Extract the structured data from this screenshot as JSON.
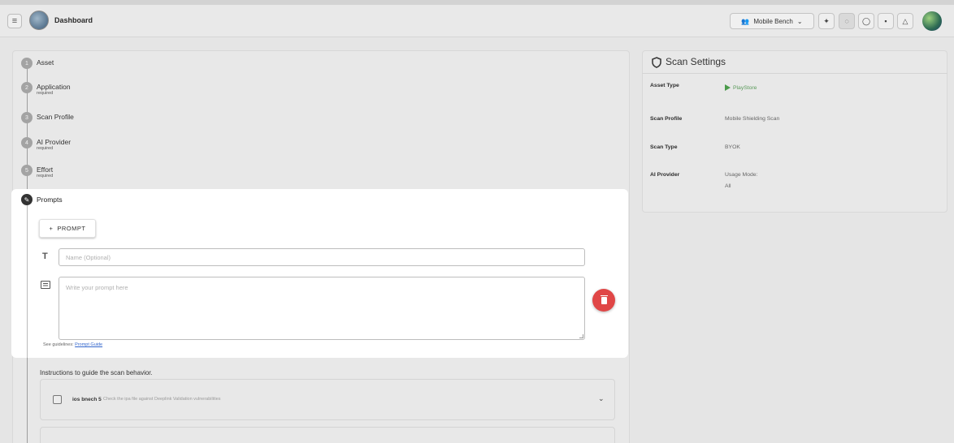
{
  "header": {
    "menu_icon": "hamburger-icon",
    "title": "Dashboard",
    "workspace_label": "Mobile Bench",
    "icons": [
      "sparkle-icon",
      "bug-icon",
      "shield-icon",
      "card-icon",
      "bell-icon"
    ]
  },
  "steps": [
    {
      "num": "1",
      "label": "Asset",
      "sub": ""
    },
    {
      "num": "2",
      "label": "Application",
      "sub": "required"
    },
    {
      "num": "3",
      "label": "Scan Profile",
      "sub": ""
    },
    {
      "num": "4",
      "label": "AI Provider",
      "sub": "required"
    },
    {
      "num": "5",
      "label": "Effort",
      "sub": "required"
    }
  ],
  "prompts": {
    "title": "Prompts",
    "add_label": "PROMPT",
    "add_plus": "+",
    "name_placeholder": "Name (Optional)",
    "prompt_placeholder": "Write your prompt here",
    "guide_text": "See guidelines:",
    "guide_link": "Prompt Guide"
  },
  "instructions": {
    "text": "Instructions to guide the scan behavior.",
    "items": [
      {
        "name": "ios bnech 5",
        "desc": "Check the ipa file against Deeplink Validation vulnerabilities"
      }
    ]
  },
  "scan_settings": {
    "title": "Scan Settings",
    "rows": [
      {
        "key": "Asset Type",
        "value": "PlayStore"
      },
      {
        "key": "Scan Profile",
        "value": "Mobile Shielding Scan"
      },
      {
        "key": "Scan Type",
        "value": "BYOK"
      },
      {
        "key": "AI Provider",
        "value": "Usage Mode:",
        "value2": "All"
      }
    ]
  },
  "colors": {
    "delete": "#e04646",
    "accent_green": "#4a9a4a",
    "link": "#3366cc"
  }
}
